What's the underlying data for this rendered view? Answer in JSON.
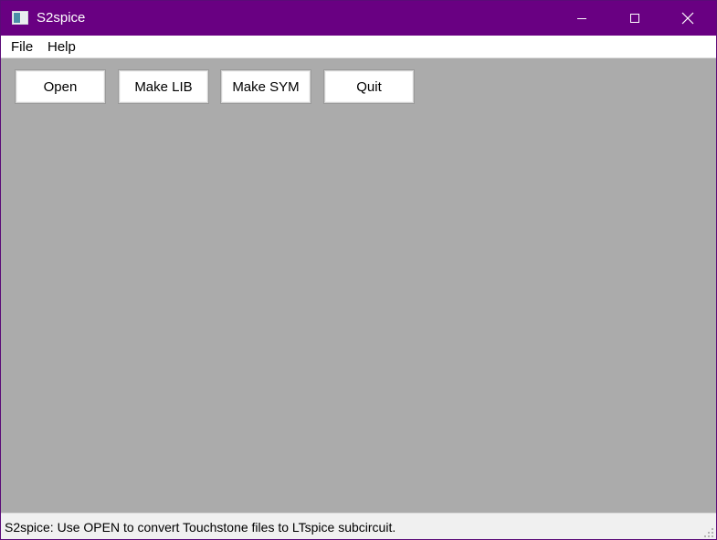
{
  "window": {
    "title": "S2spice",
    "title_bar_color": "#690082",
    "controls": {
      "minimize_icon": "minimize-icon",
      "maximize_icon": "maximize-icon",
      "close_icon": "close-icon"
    }
  },
  "menu": {
    "items": [
      {
        "label": "File"
      },
      {
        "label": "Help"
      }
    ]
  },
  "toolbar": {
    "buttons": [
      {
        "label": "Open"
      },
      {
        "label": "Make LIB"
      },
      {
        "label": "Make SYM"
      },
      {
        "label": "Quit"
      }
    ]
  },
  "content": {
    "background": "#ababab"
  },
  "status": {
    "text": "S2spice: Use OPEN to convert Touchstone files to LTspice subcircuit."
  }
}
